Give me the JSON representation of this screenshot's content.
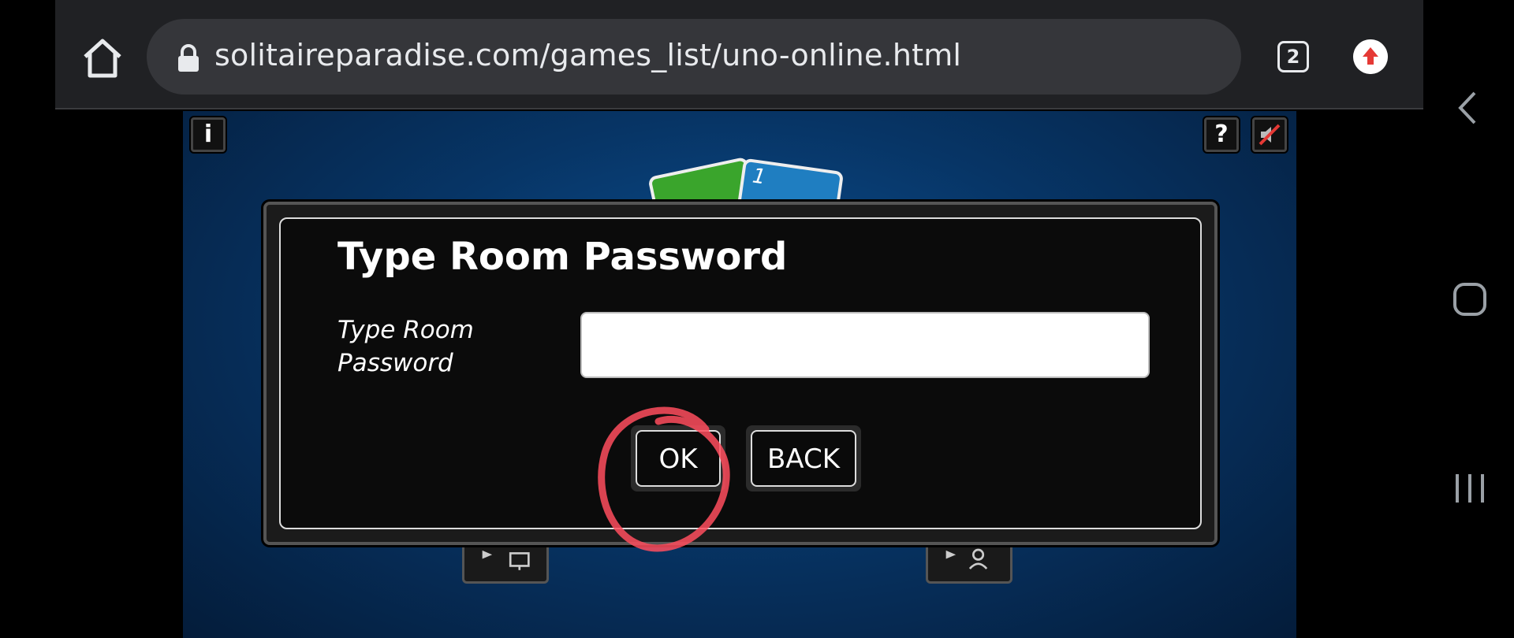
{
  "browser": {
    "url": "solitaireparadise.com/games_list/uno-online.html",
    "tab_count": "2",
    "accent_update": "#e53935"
  },
  "game": {
    "info_label": "i",
    "help_label": "?",
    "bg_color": "#0b4f91"
  },
  "dialog": {
    "title": "Type Room Password",
    "field_label": "Type Room Password",
    "password_value": "",
    "ok_label": "OK",
    "back_label": "BACK"
  },
  "cards": [
    {
      "color": "#3aa52c",
      "label": ""
    },
    {
      "color": "#1f7ec1",
      "label": "1"
    }
  ],
  "annotation_color": "#ff4d5e"
}
